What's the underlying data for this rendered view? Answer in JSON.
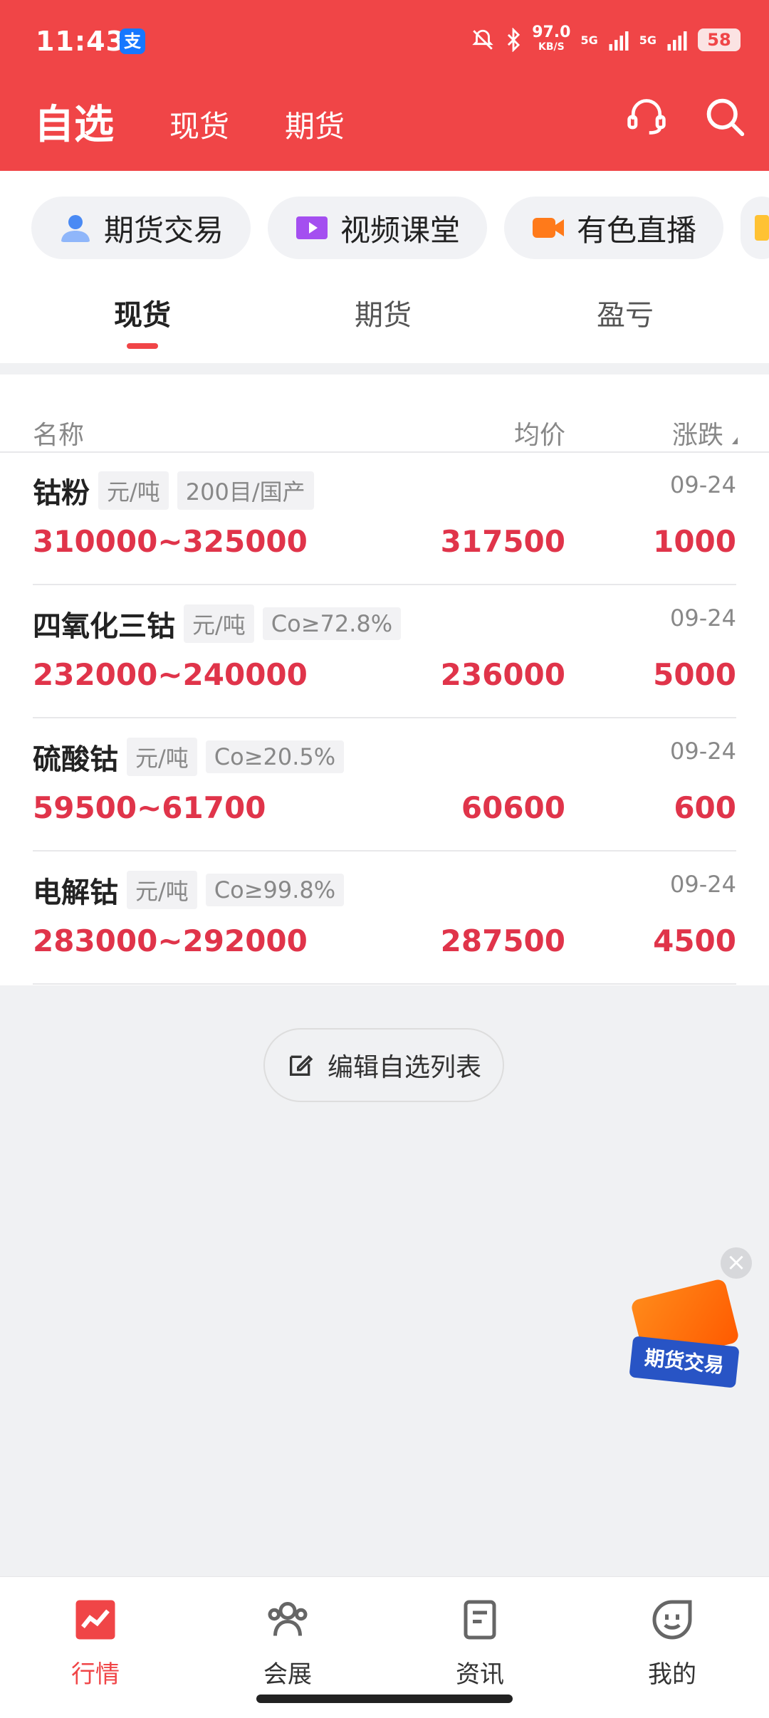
{
  "status_bar": {
    "time": "11:43",
    "alipay_glyph": "支",
    "speed_value": "97.0",
    "speed_unit": "KB/S",
    "signal1": "5G",
    "signal2": "5G",
    "battery": "58"
  },
  "header": {
    "title": "自选",
    "tabs": [
      "现货",
      "期货"
    ],
    "accent_color": "#f04547"
  },
  "quick_links": [
    {
      "label": "期货交易",
      "icon": "user-trade-icon"
    },
    {
      "label": "视频课堂",
      "icon": "video-icon"
    },
    {
      "label": "有色直播",
      "icon": "live-camera-icon"
    }
  ],
  "sub_tabs": [
    "现货",
    "期货",
    "盈亏"
  ],
  "list": {
    "columns": {
      "name": "名称",
      "avg": "均价",
      "change": "涨跌"
    },
    "rows": [
      {
        "name": "钴粉",
        "unit": "元/吨",
        "spec": "200目/国产",
        "date": "09-24",
        "range": "310000~325000",
        "avg": "317500",
        "change": "1000"
      },
      {
        "name": "四氧化三钴",
        "unit": "元/吨",
        "spec": "Co≥72.8%",
        "date": "09-24",
        "range": "232000~240000",
        "avg": "236000",
        "change": "5000"
      },
      {
        "name": "硫酸钴",
        "unit": "元/吨",
        "spec": "Co≥20.5%",
        "date": "09-24",
        "range": "59500~61700",
        "avg": "60600",
        "change": "600"
      },
      {
        "name": "电解钴",
        "unit": "元/吨",
        "spec": "Co≥99.8%",
        "date": "09-24",
        "range": "283000~292000",
        "avg": "287500",
        "change": "4500"
      }
    ]
  },
  "edit_button": "编辑自选列表",
  "float_ad": {
    "label": "期货交易",
    "close": "×"
  },
  "bottom_nav": [
    {
      "label": "行情",
      "icon": "chart-icon",
      "active": true
    },
    {
      "label": "会展",
      "icon": "people-icon",
      "active": false
    },
    {
      "label": "资讯",
      "icon": "document-icon",
      "active": false
    },
    {
      "label": "我的",
      "icon": "profile-face-icon",
      "active": false
    }
  ]
}
